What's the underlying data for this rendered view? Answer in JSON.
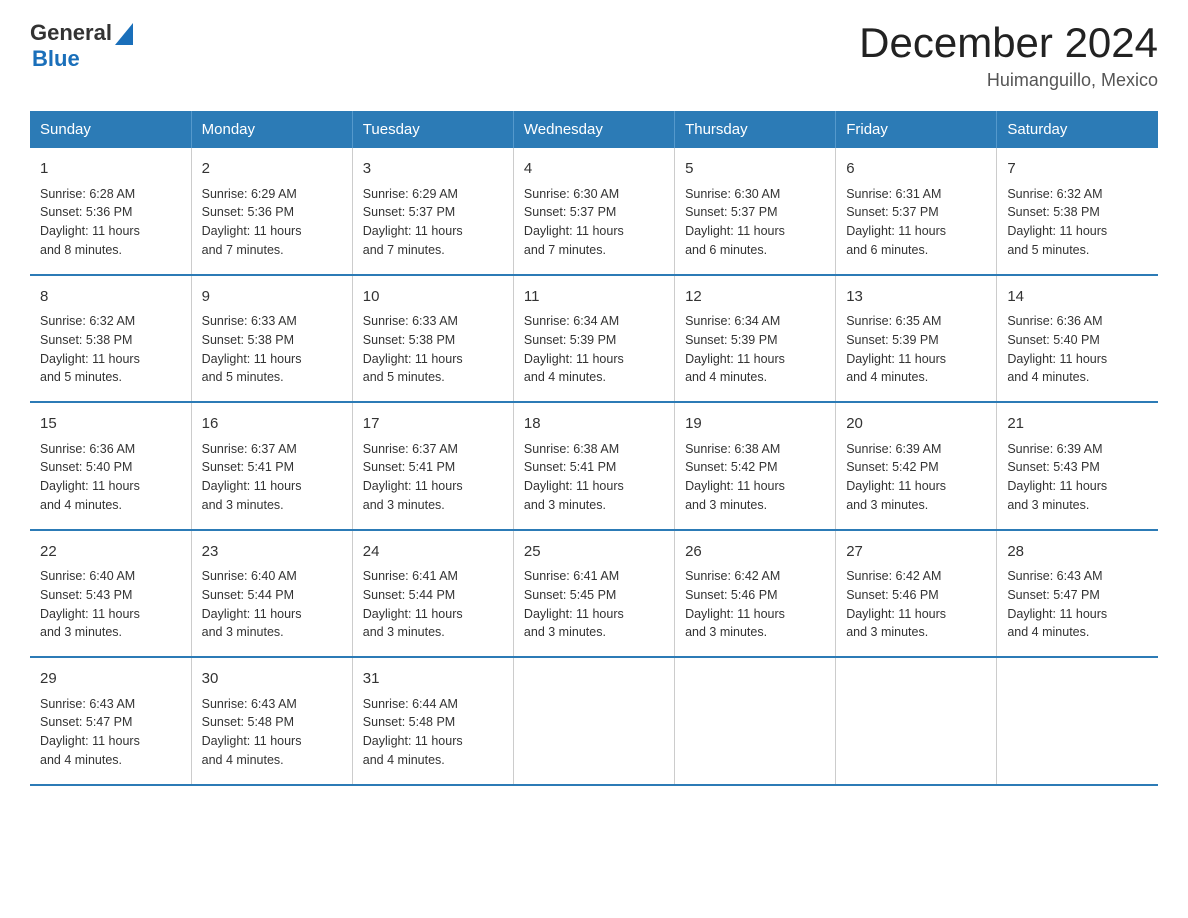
{
  "header": {
    "logo_general": "General",
    "logo_blue": "Blue",
    "title": "December 2024",
    "subtitle": "Huimanguillo, Mexico"
  },
  "days_of_week": [
    "Sunday",
    "Monday",
    "Tuesday",
    "Wednesday",
    "Thursday",
    "Friday",
    "Saturday"
  ],
  "weeks": [
    [
      {
        "day": "1",
        "info": "Sunrise: 6:28 AM\nSunset: 5:36 PM\nDaylight: 11 hours\nand 8 minutes."
      },
      {
        "day": "2",
        "info": "Sunrise: 6:29 AM\nSunset: 5:36 PM\nDaylight: 11 hours\nand 7 minutes."
      },
      {
        "day": "3",
        "info": "Sunrise: 6:29 AM\nSunset: 5:37 PM\nDaylight: 11 hours\nand 7 minutes."
      },
      {
        "day": "4",
        "info": "Sunrise: 6:30 AM\nSunset: 5:37 PM\nDaylight: 11 hours\nand 7 minutes."
      },
      {
        "day": "5",
        "info": "Sunrise: 6:30 AM\nSunset: 5:37 PM\nDaylight: 11 hours\nand 6 minutes."
      },
      {
        "day": "6",
        "info": "Sunrise: 6:31 AM\nSunset: 5:37 PM\nDaylight: 11 hours\nand 6 minutes."
      },
      {
        "day": "7",
        "info": "Sunrise: 6:32 AM\nSunset: 5:38 PM\nDaylight: 11 hours\nand 5 minutes."
      }
    ],
    [
      {
        "day": "8",
        "info": "Sunrise: 6:32 AM\nSunset: 5:38 PM\nDaylight: 11 hours\nand 5 minutes."
      },
      {
        "day": "9",
        "info": "Sunrise: 6:33 AM\nSunset: 5:38 PM\nDaylight: 11 hours\nand 5 minutes."
      },
      {
        "day": "10",
        "info": "Sunrise: 6:33 AM\nSunset: 5:38 PM\nDaylight: 11 hours\nand 5 minutes."
      },
      {
        "day": "11",
        "info": "Sunrise: 6:34 AM\nSunset: 5:39 PM\nDaylight: 11 hours\nand 4 minutes."
      },
      {
        "day": "12",
        "info": "Sunrise: 6:34 AM\nSunset: 5:39 PM\nDaylight: 11 hours\nand 4 minutes."
      },
      {
        "day": "13",
        "info": "Sunrise: 6:35 AM\nSunset: 5:39 PM\nDaylight: 11 hours\nand 4 minutes."
      },
      {
        "day": "14",
        "info": "Sunrise: 6:36 AM\nSunset: 5:40 PM\nDaylight: 11 hours\nand 4 minutes."
      }
    ],
    [
      {
        "day": "15",
        "info": "Sunrise: 6:36 AM\nSunset: 5:40 PM\nDaylight: 11 hours\nand 4 minutes."
      },
      {
        "day": "16",
        "info": "Sunrise: 6:37 AM\nSunset: 5:41 PM\nDaylight: 11 hours\nand 3 minutes."
      },
      {
        "day": "17",
        "info": "Sunrise: 6:37 AM\nSunset: 5:41 PM\nDaylight: 11 hours\nand 3 minutes."
      },
      {
        "day": "18",
        "info": "Sunrise: 6:38 AM\nSunset: 5:41 PM\nDaylight: 11 hours\nand 3 minutes."
      },
      {
        "day": "19",
        "info": "Sunrise: 6:38 AM\nSunset: 5:42 PM\nDaylight: 11 hours\nand 3 minutes."
      },
      {
        "day": "20",
        "info": "Sunrise: 6:39 AM\nSunset: 5:42 PM\nDaylight: 11 hours\nand 3 minutes."
      },
      {
        "day": "21",
        "info": "Sunrise: 6:39 AM\nSunset: 5:43 PM\nDaylight: 11 hours\nand 3 minutes."
      }
    ],
    [
      {
        "day": "22",
        "info": "Sunrise: 6:40 AM\nSunset: 5:43 PM\nDaylight: 11 hours\nand 3 minutes."
      },
      {
        "day": "23",
        "info": "Sunrise: 6:40 AM\nSunset: 5:44 PM\nDaylight: 11 hours\nand 3 minutes."
      },
      {
        "day": "24",
        "info": "Sunrise: 6:41 AM\nSunset: 5:44 PM\nDaylight: 11 hours\nand 3 minutes."
      },
      {
        "day": "25",
        "info": "Sunrise: 6:41 AM\nSunset: 5:45 PM\nDaylight: 11 hours\nand 3 minutes."
      },
      {
        "day": "26",
        "info": "Sunrise: 6:42 AM\nSunset: 5:46 PM\nDaylight: 11 hours\nand 3 minutes."
      },
      {
        "day": "27",
        "info": "Sunrise: 6:42 AM\nSunset: 5:46 PM\nDaylight: 11 hours\nand 3 minutes."
      },
      {
        "day": "28",
        "info": "Sunrise: 6:43 AM\nSunset: 5:47 PM\nDaylight: 11 hours\nand 4 minutes."
      }
    ],
    [
      {
        "day": "29",
        "info": "Sunrise: 6:43 AM\nSunset: 5:47 PM\nDaylight: 11 hours\nand 4 minutes."
      },
      {
        "day": "30",
        "info": "Sunrise: 6:43 AM\nSunset: 5:48 PM\nDaylight: 11 hours\nand 4 minutes."
      },
      {
        "day": "31",
        "info": "Sunrise: 6:44 AM\nSunset: 5:48 PM\nDaylight: 11 hours\nand 4 minutes."
      },
      {
        "day": "",
        "info": ""
      },
      {
        "day": "",
        "info": ""
      },
      {
        "day": "",
        "info": ""
      },
      {
        "day": "",
        "info": ""
      }
    ]
  ]
}
